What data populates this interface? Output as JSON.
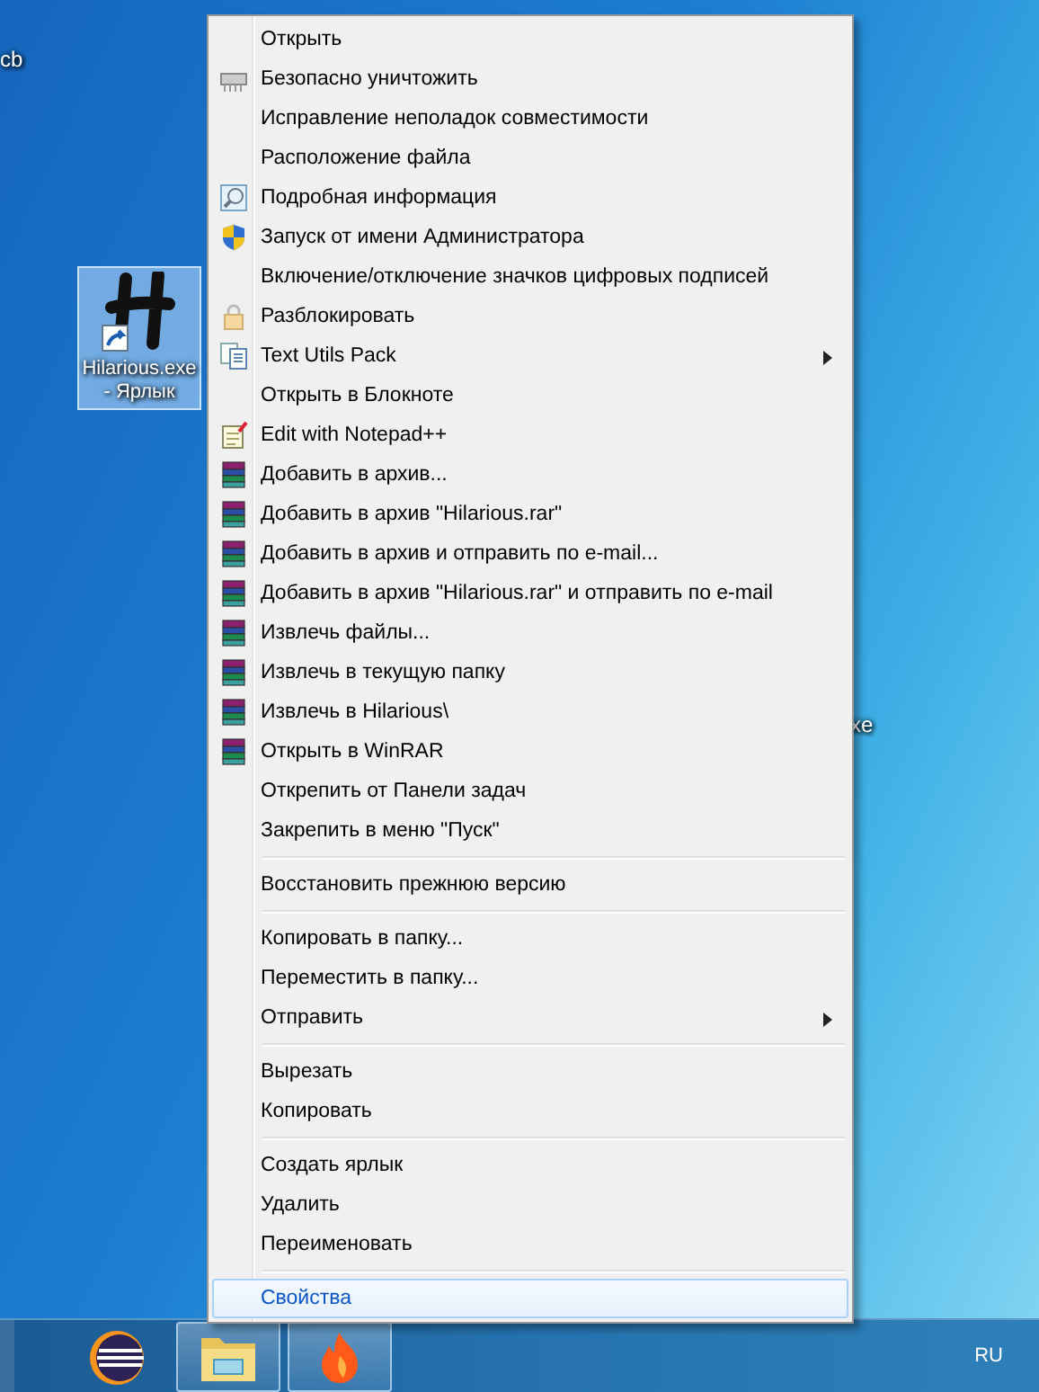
{
  "desktop": {
    "labels": [
      "cb",
      "xe"
    ],
    "shortcut": {
      "label": "Hilarious.exe - Ярлык",
      "selected": true
    }
  },
  "context_menu": {
    "groups": [
      {
        "items": [
          {
            "label": "Открыть",
            "kind": "plain",
            "submenu": false,
            "selected": false
          },
          {
            "label": "Безопасно уничтожить",
            "kind": "shredder",
            "submenu": false,
            "selected": false
          },
          {
            "label": "Исправление неполадок совместимости",
            "kind": "plain",
            "submenu": false,
            "selected": false
          },
          {
            "label": "Расположение файла",
            "kind": "plain",
            "submenu": false,
            "selected": false
          },
          {
            "label": "Подробная информация",
            "kind": "magnifier",
            "submenu": false,
            "selected": false
          },
          {
            "label": "Запуск от имени Администратора",
            "kind": "shield",
            "submenu": false,
            "selected": false
          },
          {
            "label": "Включение/отключение значков цифровых подписей",
            "kind": "plain",
            "submenu": false,
            "selected": false
          },
          {
            "label": "Разблокировать",
            "kind": "lock",
            "submenu": false,
            "selected": false
          },
          {
            "label": "Text Utils Pack",
            "kind": "documents",
            "submenu": true,
            "selected": false
          },
          {
            "label": "Открыть в Блокноте",
            "kind": "plain",
            "submenu": false,
            "selected": false
          },
          {
            "label": "Edit with Notepad++",
            "kind": "notepad",
            "submenu": false,
            "selected": false
          },
          {
            "label": "Добавить в архив...",
            "kind": "archive",
            "submenu": false,
            "selected": false
          },
          {
            "label": "Добавить в архив \"Hilarious.rar\"",
            "kind": "archive",
            "submenu": false,
            "selected": false
          },
          {
            "label": "Добавить в архив и отправить по e-mail...",
            "kind": "archive",
            "submenu": false,
            "selected": false
          },
          {
            "label": "Добавить в архив \"Hilarious.rar\" и отправить по e-mail",
            "kind": "archive",
            "submenu": false,
            "selected": false
          },
          {
            "label": "Извлечь файлы...",
            "kind": "archive",
            "submenu": false,
            "selected": false
          },
          {
            "label": "Извлечь в текущую папку",
            "kind": "archive",
            "submenu": false,
            "selected": false
          },
          {
            "label": "Извлечь в Hilarious\\",
            "kind": "archive",
            "submenu": false,
            "selected": false
          },
          {
            "label": "Открыть в WinRAR",
            "kind": "archive",
            "submenu": false,
            "selected": false
          },
          {
            "label": "Открепить от Панели задач",
            "kind": "plain",
            "submenu": false,
            "selected": false
          },
          {
            "label": "Закрепить в меню \"Пуск\"",
            "kind": "plain",
            "submenu": false,
            "selected": false
          }
        ]
      },
      {
        "items": [
          {
            "label": "Восстановить прежнюю версию",
            "kind": "plain",
            "submenu": false,
            "selected": false
          }
        ]
      },
      {
        "items": [
          {
            "label": "Копировать в папку...",
            "kind": "plain",
            "submenu": false,
            "selected": false
          },
          {
            "label": "Переместить в папку...",
            "kind": "plain",
            "submenu": false,
            "selected": false
          },
          {
            "label": "Отправить",
            "kind": "plain",
            "submenu": true,
            "selected": false
          }
        ]
      },
      {
        "items": [
          {
            "label": "Вырезать",
            "kind": "plain",
            "submenu": false,
            "selected": false
          },
          {
            "label": "Копировать",
            "kind": "plain",
            "submenu": false,
            "selected": false
          }
        ]
      },
      {
        "items": [
          {
            "label": "Создать ярлык",
            "kind": "plain",
            "submenu": false,
            "selected": false
          },
          {
            "label": "Удалить",
            "kind": "plain",
            "submenu": false,
            "selected": false
          },
          {
            "label": "Переименовать",
            "kind": "plain",
            "submenu": false,
            "selected": false
          }
        ]
      },
      {
        "items": [
          {
            "label": "Свойства",
            "kind": "plain",
            "submenu": false,
            "selected": true
          }
        ]
      }
    ]
  },
  "taskbar": {
    "apps": [
      {
        "kind": "eclipse",
        "running": false
      },
      {
        "kind": "folder",
        "running": true
      },
      {
        "kind": "flame",
        "running": true
      }
    ],
    "language": "RU"
  }
}
